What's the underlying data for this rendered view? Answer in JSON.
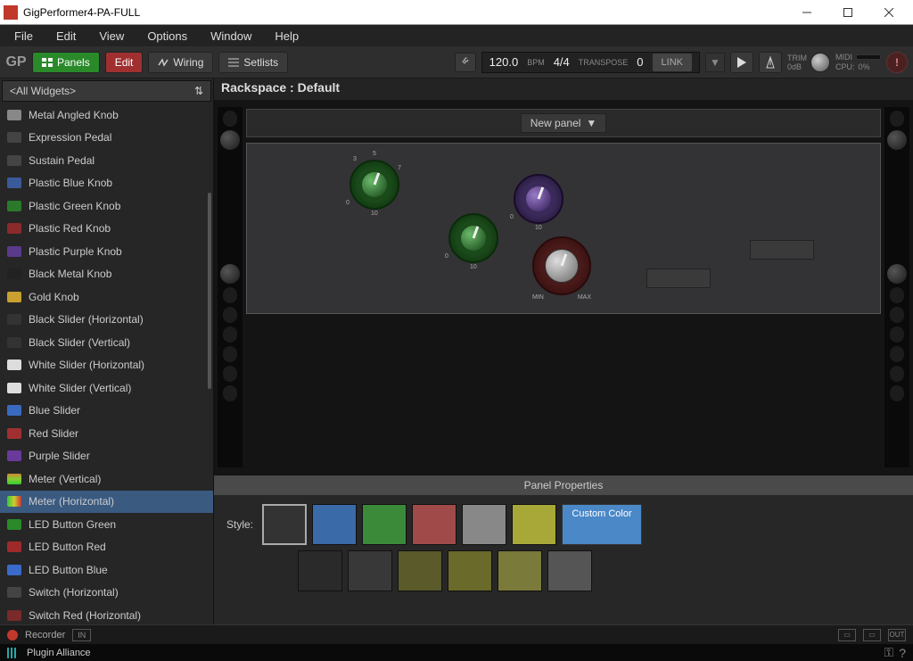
{
  "window": {
    "title": "GigPerformer4-PA-FULL"
  },
  "menu": [
    "File",
    "Edit",
    "View",
    "Options",
    "Window",
    "Help"
  ],
  "toolbar": {
    "panels": "Panels",
    "edit": "Edit",
    "wiring": "Wiring",
    "setlists": "Setlists",
    "bpm_value": "120.0",
    "bpm_label": "BPM",
    "time_sig": "4/4",
    "transpose_label": "TRANSPOSE",
    "transpose_value": "0",
    "link": "LINK",
    "trim": "TRIM",
    "trim_db": "0dB",
    "midi": "MIDI",
    "cpu_label": "CPU:",
    "cpu_value": "0%"
  },
  "sidebar": {
    "selector": "<All Widgets>",
    "items": [
      {
        "label": "Metal Angled Knob",
        "icon": "#888",
        "sel": false
      },
      {
        "label": "Expression Pedal",
        "icon": "#444",
        "sel": false
      },
      {
        "label": "Sustain Pedal",
        "icon": "#444",
        "sel": false
      },
      {
        "label": "Plastic Blue Knob",
        "icon": "#3a5a9a",
        "sel": false
      },
      {
        "label": "Plastic Green Knob",
        "icon": "#2a7a2a",
        "sel": false
      },
      {
        "label": "Plastic Red Knob",
        "icon": "#8a2a2a",
        "sel": false
      },
      {
        "label": "Plastic Purple Knob",
        "icon": "#5a3a8a",
        "sel": false
      },
      {
        "label": "Black Metal Knob",
        "icon": "#222",
        "sel": false
      },
      {
        "label": "Gold Knob",
        "icon": "#c8a030",
        "sel": false
      },
      {
        "label": "Black Slider (Horizontal)",
        "icon": "#333",
        "sel": false
      },
      {
        "label": "Black Slider (Vertical)",
        "icon": "#333",
        "sel": false
      },
      {
        "label": "White Slider (Horizontal)",
        "icon": "#ddd",
        "sel": false
      },
      {
        "label": "White Slider (Vertical)",
        "icon": "#ddd",
        "sel": false
      },
      {
        "label": "Blue Slider",
        "icon": "#3a6ac0",
        "sel": false
      },
      {
        "label": "Red Slider",
        "icon": "#a03030",
        "sel": false
      },
      {
        "label": "Purple Slider",
        "icon": "#6a3a9a",
        "sel": false
      },
      {
        "label": "Meter (Vertical)",
        "icon": "linear-gradient(#c83,#8c3,#3c3)",
        "sel": false
      },
      {
        "label": "Meter (Horizontal)",
        "icon": "linear-gradient(90deg,#3c3,#cc3,#c33)",
        "sel": true
      },
      {
        "label": "LED Button Green",
        "icon": "#2a8a2a",
        "sel": false
      },
      {
        "label": "LED Button Red",
        "icon": "#a02a2a",
        "sel": false
      },
      {
        "label": "LED Button Blue",
        "icon": "#3a6aca",
        "sel": false
      },
      {
        "label": "Switch (Horizontal)",
        "icon": "#444",
        "sel": false
      },
      {
        "label": "Switch Red (Horizontal)",
        "icon": "#7a2a2a",
        "sel": false
      }
    ]
  },
  "rackspace": {
    "title": "Rackspace : Default",
    "new_panel": "New panel",
    "knob_min": "MIN",
    "knob_max": "MAX"
  },
  "panel_props": {
    "header": "Panel Properties",
    "style_label": "Style:",
    "swatches_row1": [
      "#333333",
      "#3a6aa8",
      "#3a8a3a",
      "#a04a4a",
      "#888888",
      "#a8a838"
    ],
    "swatches_row2": [
      "#2a2a2a",
      "#383838",
      "#5a5a2a",
      "#6a6a2a",
      "#7a7a3a",
      "#555555"
    ],
    "custom_color": "Custom Color"
  },
  "bottom": {
    "recorder": "Recorder",
    "in": "IN",
    "out": "OUT"
  },
  "status": {
    "plugin_alliance": "Plugin Alliance"
  }
}
